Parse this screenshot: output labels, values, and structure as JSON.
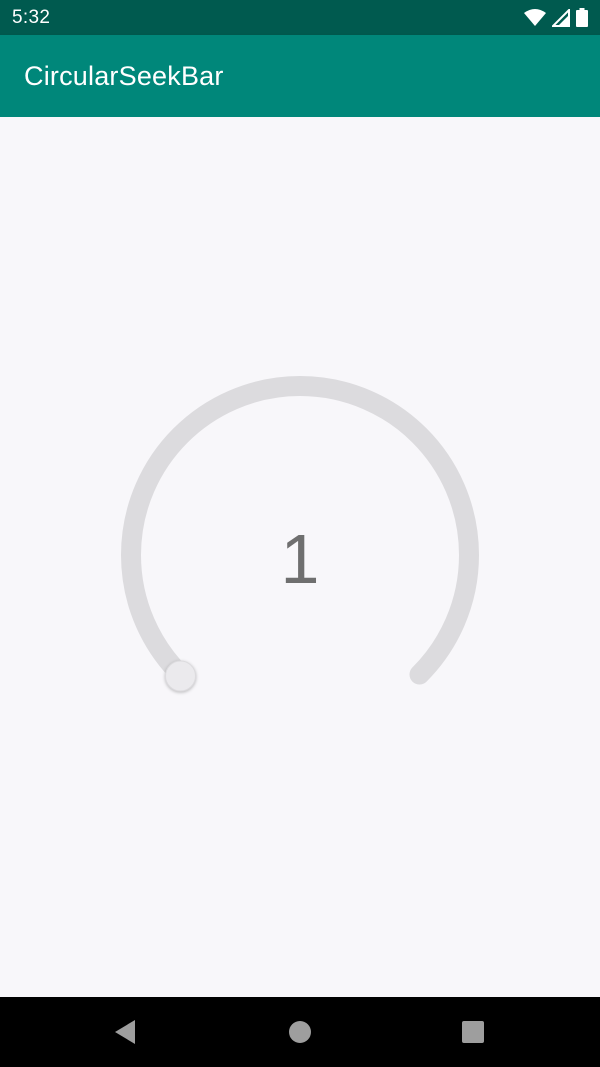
{
  "status_bar": {
    "time": "5:32",
    "icons": [
      "wifi-icon",
      "signal-icon",
      "battery-icon"
    ]
  },
  "app_bar": {
    "title": "CircularSeekBar"
  },
  "seekbar": {
    "value": "1",
    "track_color": "#dcdbde",
    "thumb_color": "#ebeaed"
  },
  "nav_bar": {
    "buttons": [
      "back-icon",
      "home-icon",
      "recents-icon"
    ]
  },
  "colors": {
    "status_bar": "#005a4f",
    "app_bar": "#00877a",
    "background": "#f8f7fa",
    "nav_bar": "#000000"
  }
}
